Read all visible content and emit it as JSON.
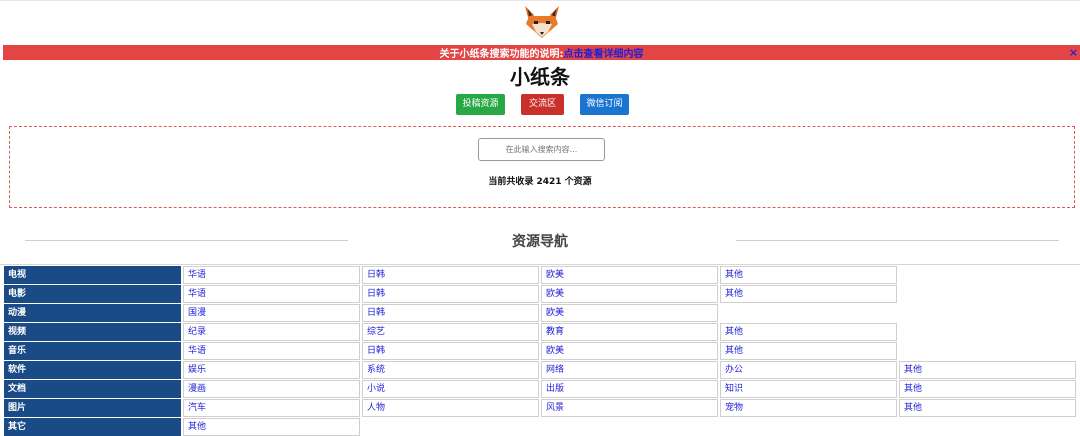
{
  "notice": {
    "text": "关于小纸条搜索功能的说明:",
    "link": "点击查看详细内容",
    "close": "×"
  },
  "site_title": "小纸条",
  "buttons": {
    "submit": "投稿资源",
    "forum": "交流区",
    "wechat": "微信订阅"
  },
  "search": {
    "placeholder": "在此输入搜索内容..."
  },
  "stats": {
    "text": "当前共收录 2421 个资源"
  },
  "nav_title": "资源导航",
  "categories": [
    {
      "name": "电视",
      "subs": [
        "华语",
        "日韩",
        "欧美",
        "其他"
      ]
    },
    {
      "name": "电影",
      "subs": [
        "华语",
        "日韩",
        "欧美",
        "其他"
      ]
    },
    {
      "name": "动漫",
      "subs": [
        "国漫",
        "日韩",
        "欧美"
      ]
    },
    {
      "name": "视频",
      "subs": [
        "纪录",
        "综艺",
        "教育",
        "其他"
      ]
    },
    {
      "name": "音乐",
      "subs": [
        "华语",
        "日韩",
        "欧美",
        "其他"
      ]
    },
    {
      "name": "软件",
      "subs": [
        "娱乐",
        "系统",
        "网络",
        "办公",
        "其他"
      ]
    },
    {
      "name": "文档",
      "subs": [
        "漫画",
        "小说",
        "出版",
        "知识",
        "其他"
      ]
    },
    {
      "name": "图片",
      "subs": [
        "汽车",
        "人物",
        "风景",
        "宠物",
        "其他"
      ]
    },
    {
      "name": "其它",
      "subs": [
        "其他"
      ]
    }
  ]
}
